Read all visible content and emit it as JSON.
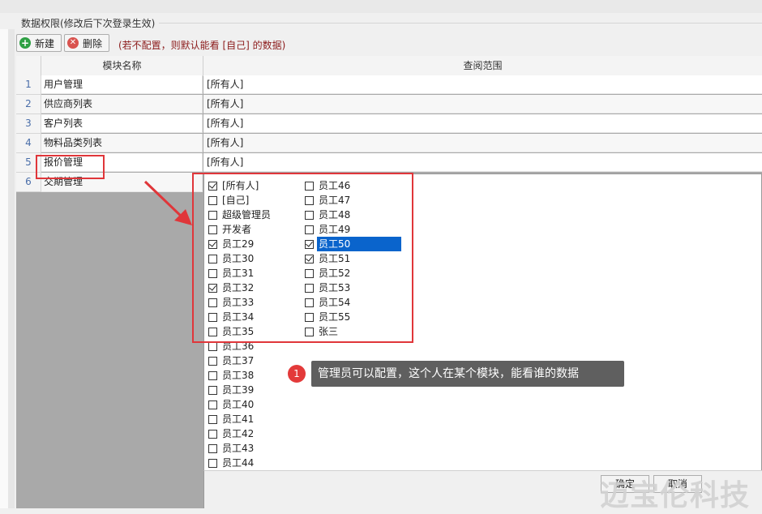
{
  "section": {
    "title": "数据权限(修改后下次登录生效)"
  },
  "toolbar": {
    "new_label": "新建",
    "delete_label": "删除",
    "hint": "(若不配置，则默认能看 [自己] 的数据)"
  },
  "table": {
    "columns": [
      "模块名称",
      "查阅范围"
    ],
    "rows": [
      {
        "num": "1",
        "module": "用户管理",
        "scope": "[所有人]"
      },
      {
        "num": "2",
        "module": "供应商列表",
        "scope": "[所有人]"
      },
      {
        "num": "3",
        "module": "客户列表",
        "scope": "[所有人]"
      },
      {
        "num": "4",
        "module": "物料品类列表",
        "scope": "[所有人]"
      },
      {
        "num": "5",
        "module": "报价管理",
        "scope": "[所有人]"
      },
      {
        "num": "6",
        "module": "交期管理",
        "scope": ""
      }
    ]
  },
  "picker": {
    "left": [
      {
        "label": "[所有人]",
        "checked": true
      },
      {
        "label": "[自己]",
        "checked": false
      },
      {
        "label": "超级管理员",
        "checked": false
      },
      {
        "label": "开发者",
        "checked": false
      },
      {
        "label": "员工29",
        "checked": true
      },
      {
        "label": "员工30",
        "checked": false
      },
      {
        "label": "员工31",
        "checked": false
      },
      {
        "label": "员工32",
        "checked": true
      },
      {
        "label": "员工33",
        "checked": false
      },
      {
        "label": "员工34",
        "checked": false
      },
      {
        "label": "员工35",
        "checked": false
      },
      {
        "label": "员工36",
        "checked": false
      },
      {
        "label": "员工37",
        "checked": false
      },
      {
        "label": "员工38",
        "checked": false
      },
      {
        "label": "员工39",
        "checked": false
      },
      {
        "label": "员工40",
        "checked": false
      },
      {
        "label": "员工41",
        "checked": false
      },
      {
        "label": "员工42",
        "checked": false
      },
      {
        "label": "员工43",
        "checked": false
      },
      {
        "label": "员工44",
        "checked": false
      }
    ],
    "right": [
      {
        "label": "员工46",
        "checked": false
      },
      {
        "label": "员工47",
        "checked": false
      },
      {
        "label": "员工48",
        "checked": false
      },
      {
        "label": "员工49",
        "checked": false
      },
      {
        "label": "员工50",
        "checked": true,
        "selected": true
      },
      {
        "label": "员工51",
        "checked": true
      },
      {
        "label": "员工52",
        "checked": false
      },
      {
        "label": "员工53",
        "checked": false
      },
      {
        "label": "员工54",
        "checked": false
      },
      {
        "label": "员工55",
        "checked": false
      },
      {
        "label": "张三",
        "checked": false
      }
    ],
    "ok_label": "确定",
    "cancel_label": "取消"
  },
  "annotation": {
    "number": "1",
    "text": "管理员可以配置，这个人在某个模块，能看谁的数据"
  },
  "watermark": "迈宝伦科技",
  "colors": {
    "accent": "#0a64cc",
    "highlight": "#e0363a",
    "hint": "#8b1a1a"
  }
}
